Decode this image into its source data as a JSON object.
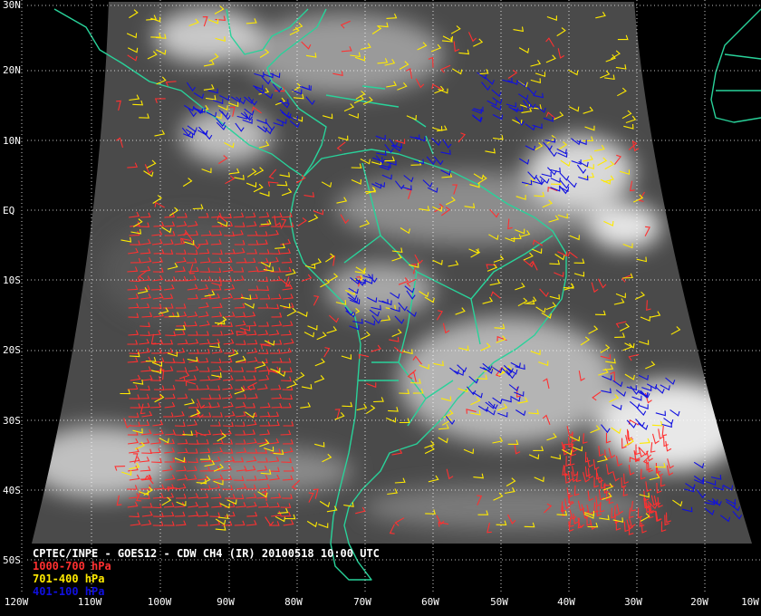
{
  "title": "CPTEC/INPE - GOES12 - CDW CH4 (IR) 20100518 10:00 UTC",
  "legend": [
    {
      "label": "1000-700 hPa",
      "color": "#ff3030"
    },
    {
      "label": "701-400 hPa",
      "color": "#ffea00"
    },
    {
      "label": "401-100 hPa",
      "color": "#1010e0"
    }
  ],
  "lat_labels": [
    "30N",
    "20N",
    "10N",
    "EQ",
    "10S",
    "20S",
    "30S",
    "40S",
    "50S"
  ],
  "lon_labels": [
    "120W",
    "110W",
    "100W",
    "90W",
    "80W",
    "70W",
    "60W",
    "50W",
    "40W",
    "30W",
    "20W",
    "10W"
  ],
  "colors": {
    "background": "#000000",
    "coastline": "#29d29a",
    "grid": "#ffffff",
    "satellite_min": "#3a3a3a",
    "satellite_max": "#f0f0f0"
  }
}
